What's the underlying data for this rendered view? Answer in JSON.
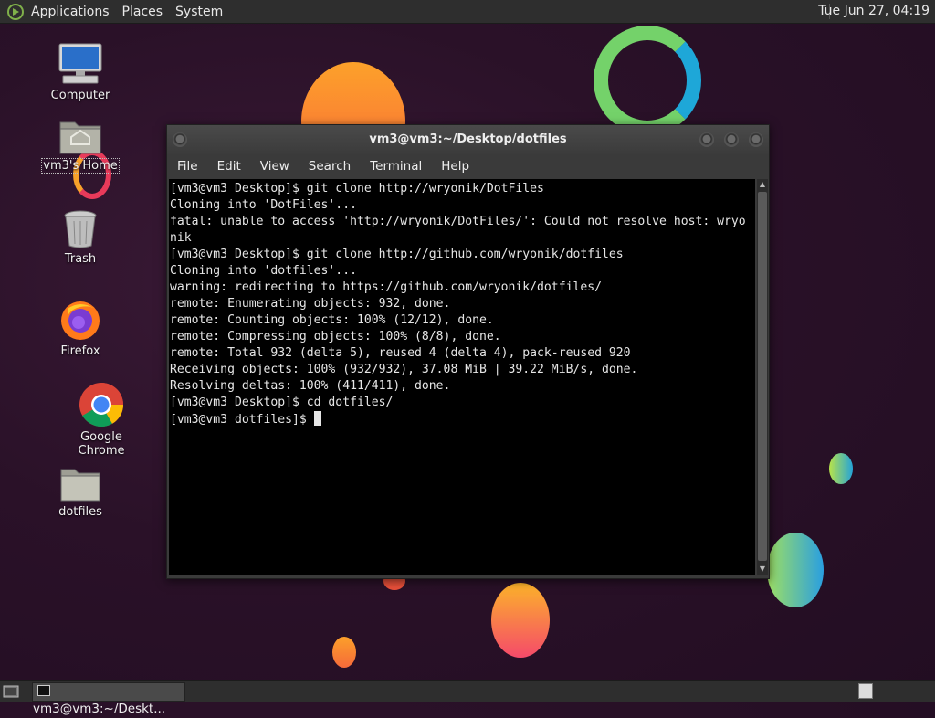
{
  "top_panel": {
    "menus": [
      "Applications",
      "Places",
      "System"
    ],
    "clock": "Tue Jun 27, 04:19"
  },
  "desktop_icons": [
    {
      "label": "Computer",
      "icon": "computer-icon"
    },
    {
      "label": "vm3's Home",
      "icon": "home-folder-icon"
    },
    {
      "label": "Trash",
      "icon": "trash-icon"
    },
    {
      "label": "Firefox",
      "icon": "firefox-icon"
    },
    {
      "label": "Google Chrome",
      "icon": "chrome-icon"
    },
    {
      "label": "dotfiles",
      "icon": "folder-icon"
    }
  ],
  "terminal": {
    "title": "vm3@vm3:~/Desktop/dotfiles",
    "menus": [
      "File",
      "Edit",
      "View",
      "Search",
      "Terminal",
      "Help"
    ],
    "lines": [
      "[vm3@vm3 Desktop]$ git clone http://wryonik/DotFiles",
      "Cloning into 'DotFiles'...",
      "fatal: unable to access 'http://wryonik/DotFiles/': Could not resolve host: wryo",
      "nik",
      "[vm3@vm3 Desktop]$ git clone http://github.com/wryonik/dotfiles",
      "Cloning into 'dotfiles'...",
      "warning: redirecting to https://github.com/wryonik/dotfiles/",
      "remote: Enumerating objects: 932, done.",
      "remote: Counting objects: 100% (12/12), done.",
      "remote: Compressing objects: 100% (8/8), done.",
      "remote: Total 932 (delta 5), reused 4 (delta 4), pack-reused 920",
      "Receiving objects: 100% (932/932), 37.08 MiB | 39.22 MiB/s, done.",
      "Resolving deltas: 100% (411/411), done.",
      "[vm3@vm3 Desktop]$ cd dotfiles/"
    ],
    "prompt": "[vm3@vm3 dotfiles]$ "
  },
  "bottom_panel": {
    "task_label": "vm3@vm3:~/Deskt..."
  },
  "colors": {
    "panel": "#2e2e2e",
    "terminal_bg": "#000000",
    "wallpaper": "#2a1128"
  }
}
